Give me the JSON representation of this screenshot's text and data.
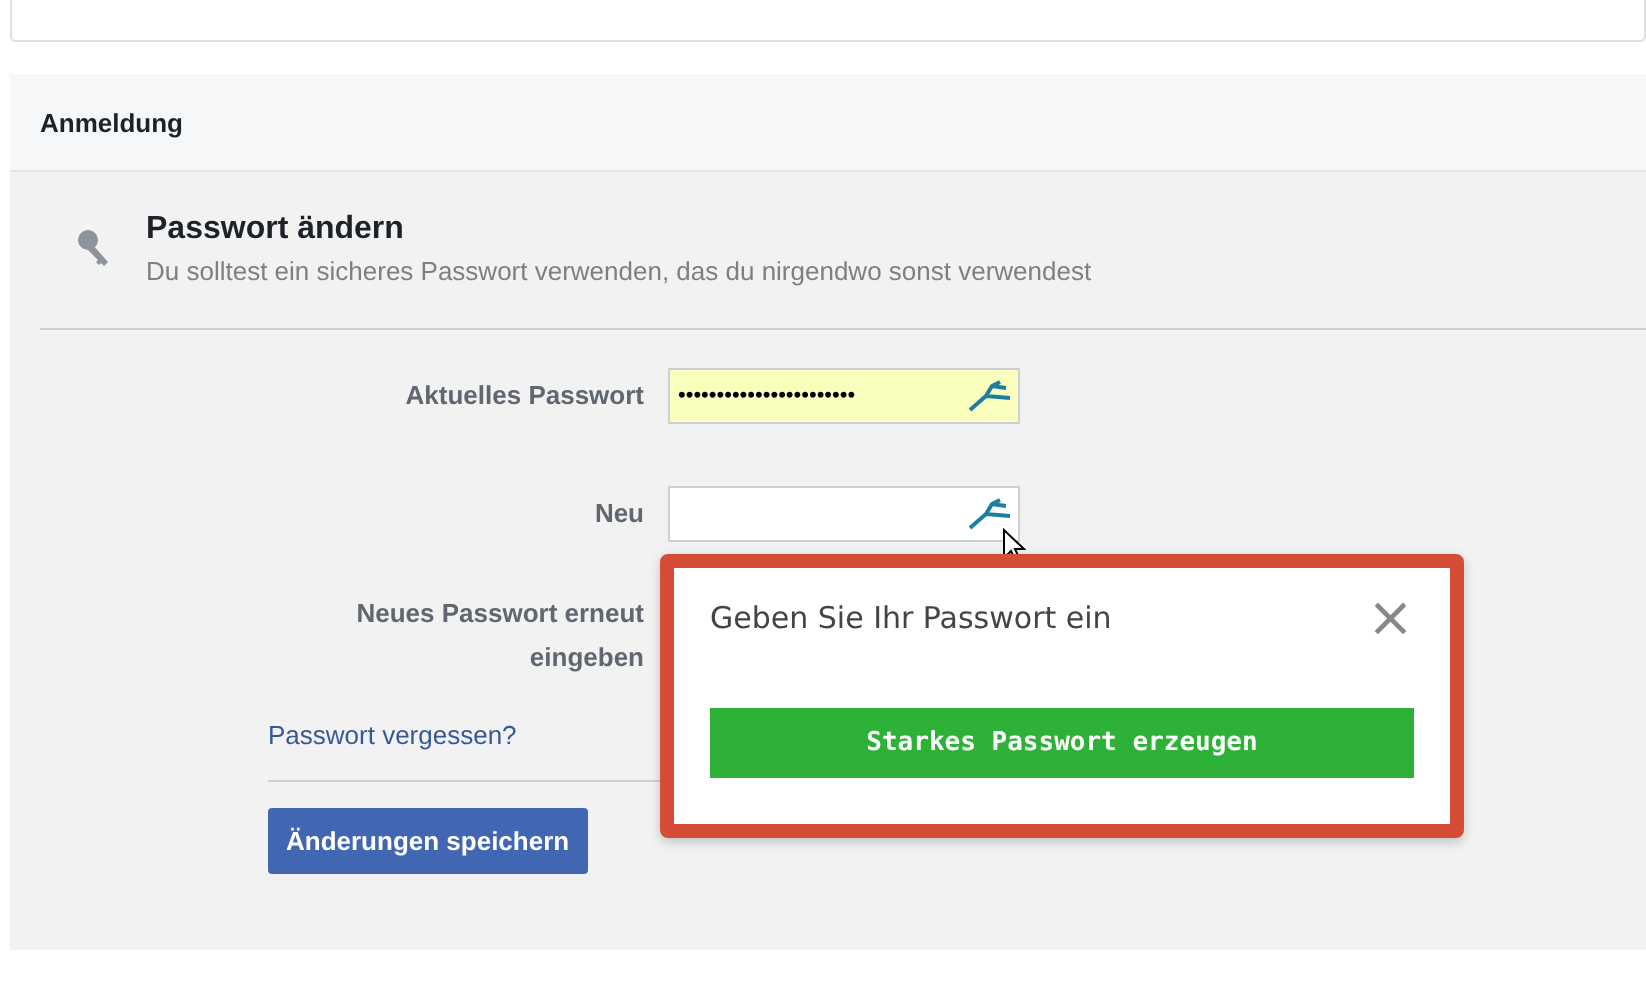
{
  "section": {
    "title": "Anmeldung"
  },
  "password_change": {
    "title": "Passwort ändern",
    "description": "Du solltest ein sicheres Passwort verwenden, das du nirgendwo sonst verwendest"
  },
  "fields": [
    {
      "label": "Aktuelles Passwort",
      "value": "•••••••••••••••••••••••",
      "autofilled": true
    },
    {
      "label": "Neu",
      "autofilled": false
    }
  ],
  "confirm_label": "Neues Passwort erneut eingeben",
  "forgot_link": "Passwort vergessen?",
  "save_button": "Änderungen speichern",
  "popup": {
    "title": "Geben Sie Ihr Passwort ein",
    "close": "×",
    "button": "Starkes Passwort erzeugen"
  }
}
